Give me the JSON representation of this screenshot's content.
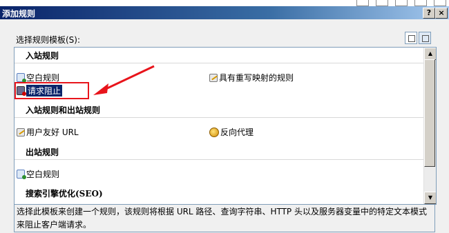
{
  "window": {
    "title": "添加规则",
    "help_label": "?",
    "close_label": "×"
  },
  "template_label": "选择规则模板(S):",
  "sections": [
    {
      "title": "入站规则",
      "items": [
        {
          "label": "空白规则",
          "icon": "blank-rule-icon"
        },
        {
          "label": "具有重写映射的规则",
          "icon": "rewrite-map-icon"
        },
        {
          "label": "请求阻止",
          "icon": "request-block-icon",
          "selected": true
        }
      ]
    },
    {
      "title": "入站规则和出站规则",
      "items": [
        {
          "label": "用户友好 URL",
          "icon": "friendly-url-icon"
        },
        {
          "label": "反向代理",
          "icon": "reverse-proxy-icon"
        }
      ]
    },
    {
      "title": "出站规则",
      "items": [
        {
          "label": "空白规则",
          "icon": "blank-rule-icon"
        }
      ]
    },
    {
      "title": "搜索引擎优化(SEO)",
      "items": []
    }
  ],
  "description": "选择此模板来创建一个规则，该规则将根据 URL 路径、查询字符串、HTTP 头以及服务器变量中的特定文本模式来阻止客户端请求。",
  "scrollbar": {
    "up": "▲",
    "down": "▼"
  },
  "colors": {
    "annotation": "#e8141b",
    "titlebar": "#0a246a",
    "selection": "#0a246a"
  }
}
